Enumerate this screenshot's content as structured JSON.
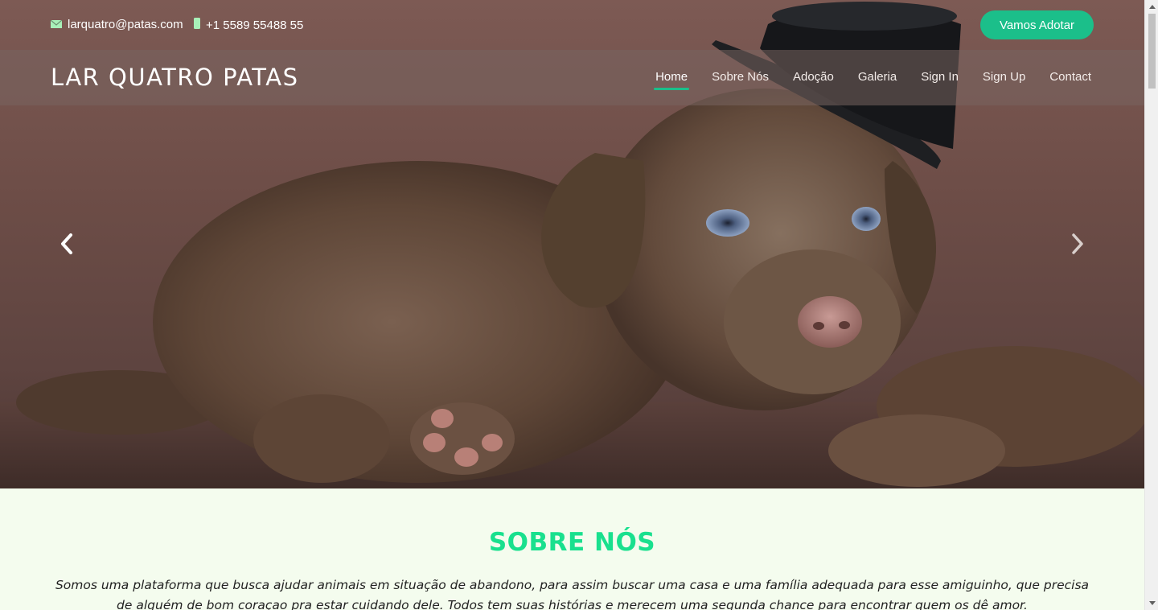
{
  "topbar": {
    "email": "larquatro@patas.com",
    "phone": "+1 5589 55488 55",
    "adopt_button": "Vamos Adotar"
  },
  "header": {
    "brand": "LAR QUATRO PATAS",
    "nav": [
      {
        "label": "Home",
        "active": true
      },
      {
        "label": "Sobre Nós",
        "active": false
      },
      {
        "label": "Adoção",
        "active": false
      },
      {
        "label": "Galeria",
        "active": false
      },
      {
        "label": "Sign In",
        "active": false
      },
      {
        "label": "Sign Up",
        "active": false
      },
      {
        "label": "Contact",
        "active": false
      }
    ]
  },
  "hero": {
    "image": "chocolate-labrador-puppy-with-top-hat",
    "prev_icon": "chevron-left-icon",
    "next_icon": "chevron-right-icon"
  },
  "about": {
    "title": "SOBRE NÓS",
    "text": "Somos uma plataforma que busca ajudar animais em situação de abandono, para assim buscar uma casa e uma família adequada para esse amiguinho, que precisa de alguém de bom coraçao pra estar cuidando dele. Todos tem suas histórias e merecem uma segunda chance para encontrar quem os dê amor."
  },
  "colors": {
    "accent": "#1bbf8a",
    "title": "#19e08e",
    "background": "#f4fcee"
  }
}
